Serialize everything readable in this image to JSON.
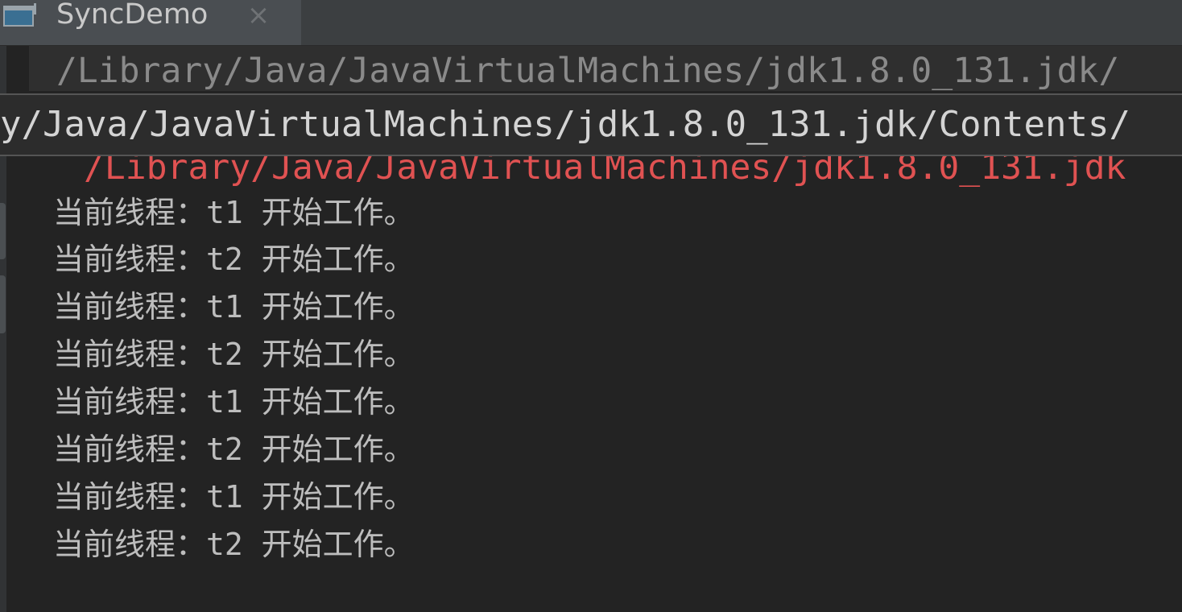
{
  "tab": {
    "title": "SyncDemo",
    "icon": "console-window-icon",
    "close_glyph": "×",
    "close_icon": "close-icon"
  },
  "console": {
    "command": "/Library/Java/JavaVirtualMachines/jdk1.8.0_131.jdk/",
    "error_line": "/Library/Java/JavaVirtualMachines/jdk1.8.0_131.jdk",
    "output": [
      "当前线程：t1 开始工作。",
      "当前线程：t2 开始工作。",
      "当前线程：t1 开始工作。",
      "当前线程：t2 开始工作。",
      "当前线程：t1 开始工作。",
      "当前线程：t2 开始工作。",
      "当前线程：t1 开始工作。",
      "当前线程：t2 开始工作。"
    ]
  },
  "tooltip": {
    "text": "y/Java/JavaVirtualMachines/jdk1.8.0_131.jdk/Contents/"
  },
  "colors": {
    "background": "#232323",
    "output_text": "#bdbdbd",
    "error_text": "#e05252",
    "command_text": "#8a8a8a",
    "tab_background": "#4a4e52"
  }
}
